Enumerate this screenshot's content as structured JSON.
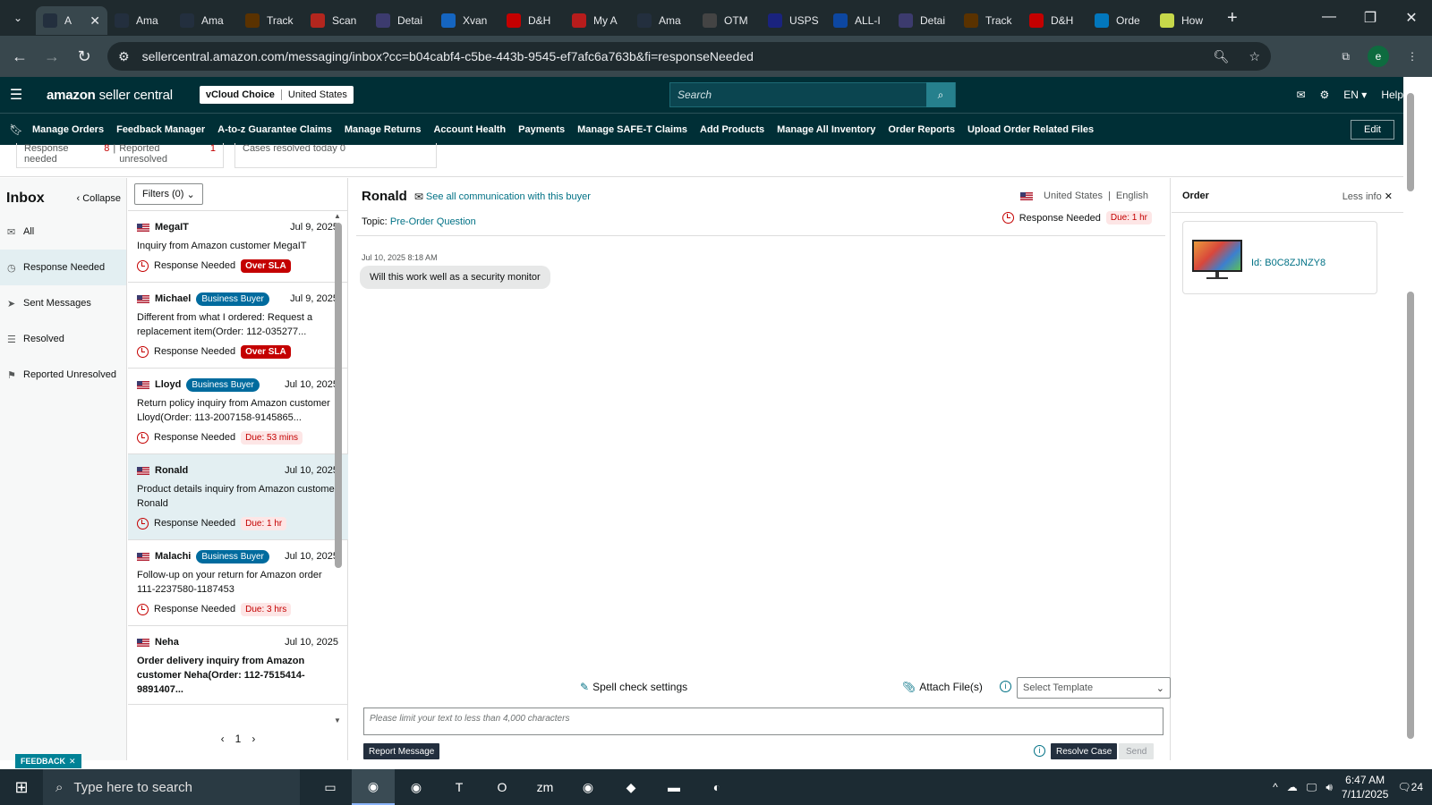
{
  "browser": {
    "tabs": [
      {
        "title": "A",
        "icon": "amazon-icon",
        "active": true
      },
      {
        "title": "Ama",
        "icon": "amazon-icon"
      },
      {
        "title": "Ama",
        "icon": "amazon-icon"
      },
      {
        "title": "Track",
        "icon": "ups-icon"
      },
      {
        "title": "Scan",
        "icon": "scan-icon"
      },
      {
        "title": "Detai",
        "icon": "flag-icon"
      },
      {
        "title": "Xvan",
        "icon": "xvan-icon"
      },
      {
        "title": "D&H",
        "icon": "dh-icon"
      },
      {
        "title": "My A",
        "icon": "mya-icon"
      },
      {
        "title": "Ama",
        "icon": "amazon-icon"
      },
      {
        "title": "OTM",
        "icon": "otm-icon"
      },
      {
        "title": "USPS",
        "icon": "usps-icon"
      },
      {
        "title": "ALL-I",
        "icon": "allin-icon"
      },
      {
        "title": "Detai",
        "icon": "flag-icon"
      },
      {
        "title": "Track",
        "icon": "ups-icon"
      },
      {
        "title": "D&H",
        "icon": "dh-icon"
      },
      {
        "title": "Orde",
        "icon": "ec-icon"
      },
      {
        "title": "How",
        "icon": "how-icon"
      }
    ],
    "url": "sellercentral.amazon.com/messaging/inbox?cc=b04cabf4-c5be-443b-9545-ef7afc6a763b&fi=responseNeeded",
    "profile_initial": "e"
  },
  "header": {
    "logo_amazon": "amazon",
    "logo_rest": "seller central",
    "account_name": "vCloud Choice",
    "marketplace": "United States",
    "search_placeholder": "Search",
    "language": "EN",
    "help": "Help"
  },
  "nav": {
    "links": [
      "Manage Orders",
      "Feedback Manager",
      "A-to-z Guarantee Claims",
      "Manage Returns",
      "Account Health",
      "Payments",
      "Manage SAFE-T Claims",
      "Add Products",
      "Manage All Inventory",
      "Order Reports",
      "Upload Order Related Files"
    ],
    "edit": "Edit"
  },
  "summary": {
    "response_needed_label": "Response needed",
    "response_needed_count": "8",
    "reported_unresolved_label": "Reported unresolved",
    "reported_unresolved_count": "1",
    "cases_resolved_label": "Cases resolved today 0"
  },
  "inbox": {
    "title": "Inbox",
    "collapse": "Collapse",
    "items": [
      {
        "label": "All",
        "icon": "envelope-icon"
      },
      {
        "label": "Response Needed",
        "icon": "clock-icon",
        "selected": true
      },
      {
        "label": "Sent Messages",
        "icon": "send-icon"
      },
      {
        "label": "Resolved",
        "icon": "resolved-icon"
      },
      {
        "label": "Reported Unresolved",
        "icon": "reported-icon"
      }
    ],
    "feedback": "FEEDBACK"
  },
  "list": {
    "filters": "Filters (0)",
    "messages": [
      {
        "name": "MegaIT",
        "badge": "",
        "date": "Jul 9, 2025",
        "subject": "Inquiry from Amazon customer MegaIT",
        "status": "Response Needed",
        "tag": "Over SLA",
        "tag_type": "sla"
      },
      {
        "name": "Michael",
        "badge": "Business Buyer",
        "date": "Jul 9, 2025",
        "subject": "Different from what I ordered: Request a replacement item(Order: 112-035277...",
        "status": "Response Needed",
        "tag": "Over SLA",
        "tag_type": "sla"
      },
      {
        "name": "Lloyd",
        "badge": "Business Buyer",
        "date": "Jul 10, 2025",
        "subject": "Return policy inquiry from Amazon customer Lloyd(Order: 113-2007158-9145865...",
        "status": "Response Needed",
        "tag": "Due: 53 mins",
        "tag_type": "due"
      },
      {
        "name": "Ronald",
        "badge": "",
        "date": "Jul 10, 2025",
        "subject": "Product details inquiry from Amazon customer Ronald",
        "status": "Response Needed",
        "tag": "Due: 1 hr",
        "tag_type": "due",
        "selected": true
      },
      {
        "name": "Malachi",
        "badge": "Business Buyer",
        "date": "Jul 10, 2025",
        "subject": "Follow-up on your return for Amazon order 111-2237580-1187453",
        "status": "Response Needed",
        "tag": "Due: 3 hrs",
        "tag_type": "due"
      },
      {
        "name": "Neha",
        "badge": "",
        "date": "Jul 10, 2025",
        "subject": "Order delivery inquiry from Amazon customer Neha(Order: 112-7515414-9891407...",
        "status": "",
        "tag": "",
        "tag_type": "",
        "bold": true
      }
    ],
    "page": "1"
  },
  "conversation": {
    "buyer": "Ronald",
    "see_all": "See all communication with this buyer",
    "country": "United States",
    "language": "English",
    "topic_label": "Topic:",
    "topic_value": "Pre-Order Question",
    "status": "Response Needed",
    "due": "Due: 1 hr",
    "timestamp": "Jul 10, 2025 8:18 AM",
    "message": "Will this work well as a security monitor",
    "spell_check": "Spell check settings",
    "attach": "Attach File(s)",
    "template_placeholder": "Select Template",
    "textarea_placeholder": "Please limit your text to less than 4,000 characters",
    "report": "Report Message",
    "resolve": "Resolve Case",
    "send": "Send"
  },
  "order": {
    "title": "Order",
    "less_info": "Less info",
    "id": "Id: B0C8ZJNZY8"
  },
  "taskbar": {
    "search_placeholder": "Type here to search",
    "time": "6:47 AM",
    "date": "7/11/2025",
    "notifications": "24"
  }
}
